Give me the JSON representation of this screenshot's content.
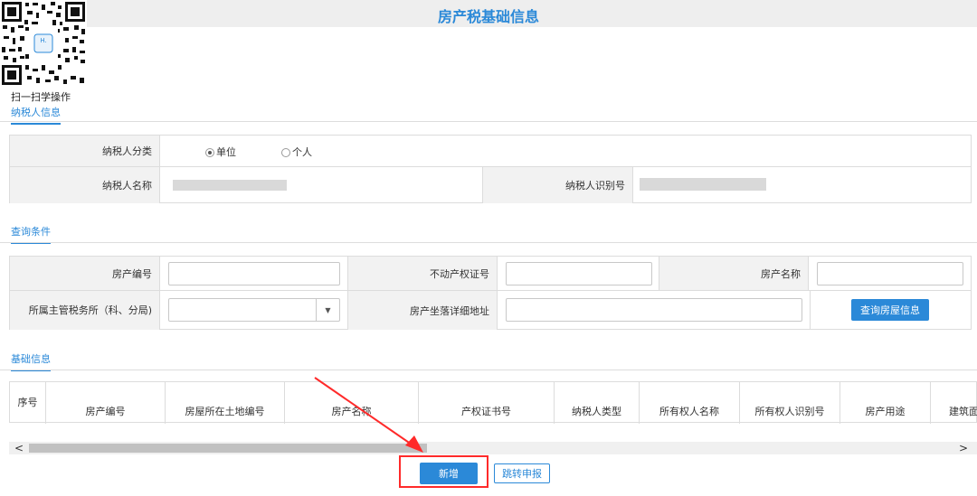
{
  "page": {
    "title": "房产税基础信息"
  },
  "qr": {
    "caption": "扫一扫学操作",
    "logo_text": "H."
  },
  "sections": {
    "taxpayer": "纳税人信息",
    "query": "查询条件",
    "basic": "基础信息"
  },
  "taxpayer_info": {
    "category_label": "纳税人分类",
    "option_unit": "单位",
    "option_personal": "个人",
    "selected": "单位",
    "name_label": "纳税人名称",
    "id_label": "纳税人识别号"
  },
  "query": {
    "property_no_label": "房产编号",
    "cert_no_label": "不动产权证号",
    "property_name_label": "房产名称",
    "tax_office_label": "所属主管税务所（科、分局)",
    "address_label": "房产坐落详细地址",
    "search_button": "查询房屋信息"
  },
  "table": {
    "columns": [
      "序号",
      "房产编号",
      "房屋所在土地编号",
      "房产名称",
      "产权证书号",
      "纳税人类型",
      "所有权人名称",
      "所有权人识别号",
      "房产用途",
      "建筑面"
    ]
  },
  "actions": {
    "add_button": "新增",
    "jump_button": "跳转申报"
  },
  "colors": {
    "accent": "#2b89d8",
    "annotation": "#ff2a2a"
  }
}
